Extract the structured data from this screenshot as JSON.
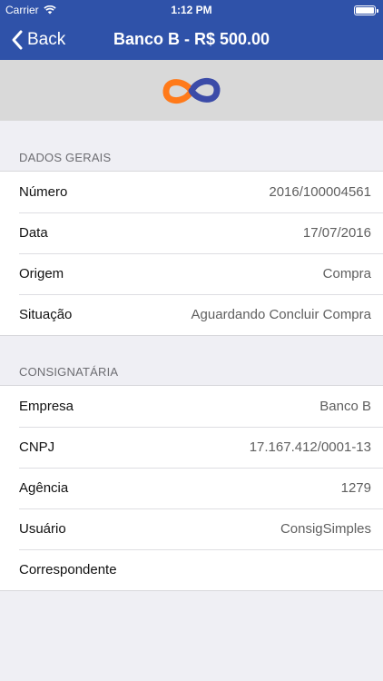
{
  "status_bar": {
    "carrier": "Carrier",
    "time": "1:12 PM",
    "battery_level": 1.0
  },
  "nav": {
    "back_label": "Back",
    "title": "Banco B - R$ 500.00"
  },
  "logo": {
    "colors": [
      "#ff7a1a",
      "#3b4ba8"
    ]
  },
  "sections": [
    {
      "title": "DADOS GERAIS",
      "rows": [
        {
          "label": "Número",
          "value": "2016/100004561"
        },
        {
          "label": "Data",
          "value": "17/07/2016"
        },
        {
          "label": "Origem",
          "value": "Compra"
        },
        {
          "label": "Situação",
          "value": "Aguardando Concluir Compra"
        }
      ]
    },
    {
      "title": "CONSIGNATÁRIA",
      "rows": [
        {
          "label": "Empresa",
          "value": "Banco B"
        },
        {
          "label": "CNPJ",
          "value": "17.167.412/0001-13"
        },
        {
          "label": "Agência",
          "value": "1279"
        },
        {
          "label": "Usuário",
          "value": "ConsigSimples"
        },
        {
          "label": "Correspondente",
          "value": ""
        }
      ]
    }
  ],
  "colors": {
    "nav_bar": "#2f52a9",
    "background": "#efeff4",
    "logo_band": "#d9d9d9"
  }
}
